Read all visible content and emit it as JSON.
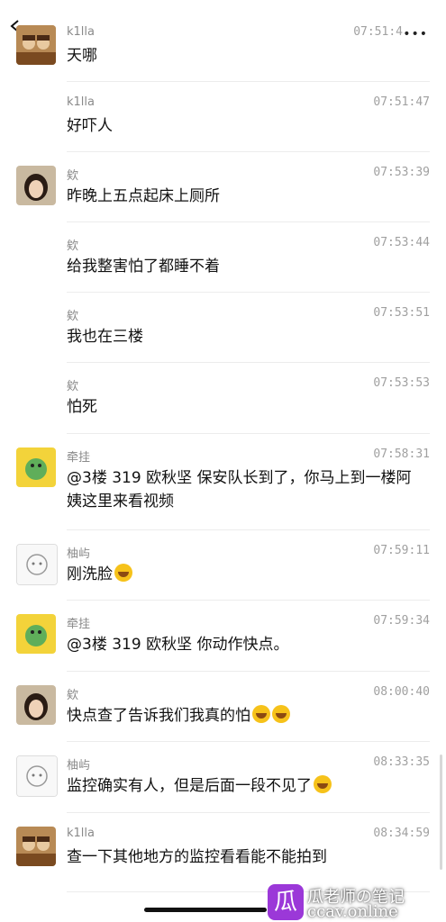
{
  "header": {
    "more_label": "•••"
  },
  "messages": [
    {
      "sender": "k1lla",
      "time": "07:51:4",
      "text": "天哪",
      "avatar": "k1lla-avatar"
    },
    {
      "sender": "k1lla",
      "time": "07:51:47",
      "text": "好吓人",
      "avatar": null
    },
    {
      "sender": "欸",
      "time": "07:53:39",
      "text": "昨晚上五点起床上厕所",
      "avatar": "girl-avatar"
    },
    {
      "sender": "欸",
      "time": "07:53:44",
      "text": "给我整害怕了都睡不着",
      "avatar": null
    },
    {
      "sender": "欸",
      "time": "07:53:51",
      "text": "我也在三楼",
      "avatar": null
    },
    {
      "sender": "欸",
      "time": "07:53:53",
      "text": "怕死",
      "avatar": null
    },
    {
      "sender": "牵挂",
      "time": "07:58:31",
      "text": "@3楼 319 欧秋坚 保安队长到了，你马上到一楼阿姨这里来看视频",
      "avatar": "cartoon-avatar"
    },
    {
      "sender": "柚屿",
      "time": "07:59:11",
      "text": "刚洗脸",
      "avatar": "sketch-avatar",
      "emoji": "laugh-cry-emoji"
    },
    {
      "sender": "牵挂",
      "time": "07:59:34",
      "text": "@3楼 319 欧秋坚 你动作快点。",
      "avatar": "cartoon-avatar"
    },
    {
      "sender": "欸",
      "time": "08:00:40",
      "text": "快点查了告诉我们我真的怕",
      "avatar": "girl-avatar",
      "emoji": "crying-emoji"
    },
    {
      "sender": "柚屿",
      "time": "08:33:35",
      "text": "监控确实有人，但是后面一段不见了",
      "avatar": "sketch-avatar",
      "emoji": "laugh-cry-emoji"
    },
    {
      "sender": "k1lla",
      "time": "08:34:59",
      "text": "查一下其他地方的监控看看能不能拍到",
      "avatar": "k1lla-avatar"
    }
  ],
  "watermark": {
    "logo": "瓜",
    "line1": "瓜老师の笔记",
    "line2": "ccav.online"
  }
}
